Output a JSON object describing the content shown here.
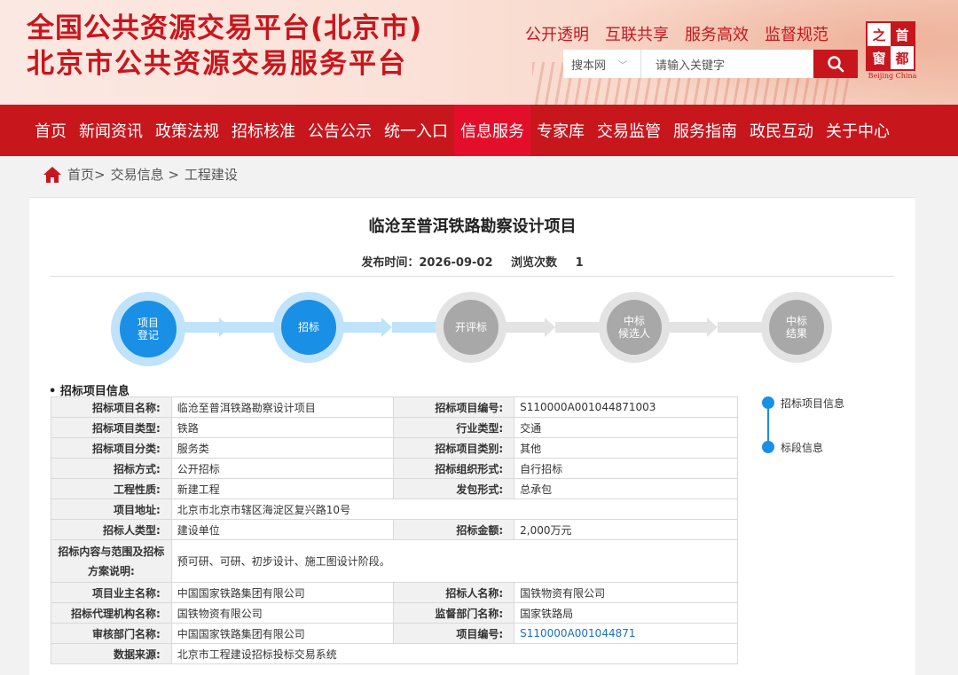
{
  "header": {
    "title_line1": "全国公共资源交易平台(北京市)",
    "title_line2": "北京市公共资源交易服务平台",
    "quick_links": [
      "公开透明",
      "互联共享",
      "服务高效",
      "监督规范"
    ],
    "search": {
      "scope": "搜本网",
      "placeholder": "请输入关键字"
    },
    "logo": {
      "chars": [
        "之",
        "首",
        "窗",
        "都"
      ],
      "english": "Beijing China"
    }
  },
  "nav": {
    "items": [
      "首页",
      "新闻资讯",
      "政策法规",
      "招标核准",
      "公告公示",
      "统一入口",
      "信息服务",
      "专家库",
      "交易监管",
      "服务指南",
      "政民互动",
      "关于中心"
    ],
    "active_index": 6
  },
  "breadcrumb": {
    "home": "首页>",
    "level1": "交易信息 >",
    "level2": "工程建设"
  },
  "project": {
    "title": "临沧至普洱铁路勘察设计项目",
    "publish_label": "发布时间：2026-09-02",
    "views_label": "浏览次数",
    "views_value": "1"
  },
  "steps": [
    {
      "label": "项目\n登记",
      "state": "done"
    },
    {
      "label": "招标",
      "state": "current"
    },
    {
      "label": "开评标",
      "state": "pending"
    },
    {
      "label": "中标\n候选人",
      "state": "pending"
    },
    {
      "label": "中标\n结果",
      "state": "pending"
    }
  ],
  "section_title": "• 招标项目信息",
  "info": {
    "r1": {
      "l1": "招标项目名称:",
      "v1": "临沧至普洱铁路勘察设计项目",
      "l2": "招标项目编号:",
      "v2": "S110000A001044871003"
    },
    "r2": {
      "l1": "招标项目类型:",
      "v1": "铁路",
      "l2": "行业类型:",
      "v2": "交通"
    },
    "r3": {
      "l1": "招标项目分类:",
      "v1": "服务类",
      "l2": "招标项目类别:",
      "v2": "其他"
    },
    "r4": {
      "l1": "招标方式:",
      "v1": "公开招标",
      "l2": "招标组织形式:",
      "v2": "自行招标"
    },
    "r5": {
      "l1": "工程性质:",
      "v1": "新建工程",
      "l2": "发包形式:",
      "v2": "总承包"
    },
    "r6": {
      "l1": "项目地址:",
      "v1": "北京市北京市辖区海淀区复兴路10号"
    },
    "r7": {
      "l1": "招标人类型:",
      "v1": "建设单位",
      "l2": "招标金额:",
      "v2": "2,000万元"
    },
    "r8": {
      "l1": "招标内容与范围及招标方案说明:",
      "v1": "预可研、可研、初步设计、施工图设计阶段。"
    },
    "r9": {
      "l1": "项目业主名称:",
      "v1": "中国国家铁路集团有限公司",
      "l2": "招标人名称:",
      "v2": "国铁物资有限公司"
    },
    "r10": {
      "l1": "招标代理机构名称:",
      "v1": "国铁物资有限公司",
      "l2": "监督部门名称:",
      "v2": "国家铁路局"
    },
    "r11": {
      "l1": "审核部门名称:",
      "v1": "中国国家铁路集团有限公司",
      "l2": "项目编号:",
      "v2": "S110000A001044871"
    },
    "r12": {
      "l1": "数据来源:",
      "v1": "北京市工程建设招标投标交易系统"
    }
  },
  "anchors": [
    "招标项目信息",
    "标段信息"
  ],
  "colors": {
    "brand_red": "#c8161d",
    "nav_active": "#e30f2a",
    "step_blue": "#1a8fe6",
    "link_blue": "#1a6fc2"
  }
}
